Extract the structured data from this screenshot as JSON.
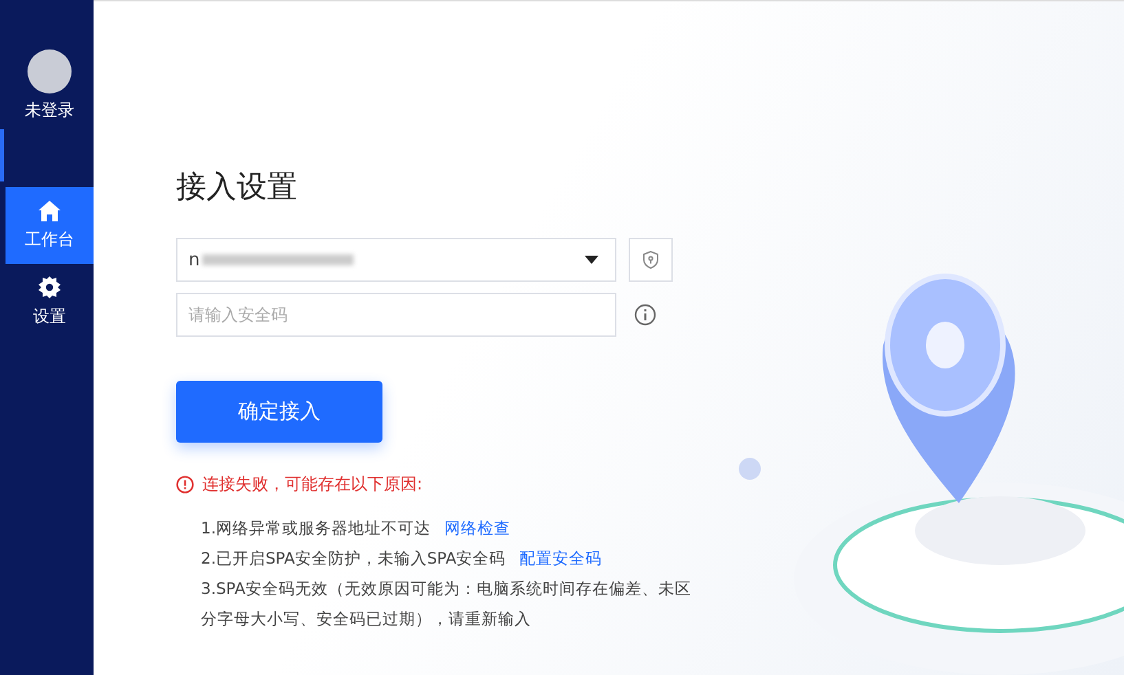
{
  "sidebar": {
    "user": {
      "name": "未登录"
    },
    "items": [
      {
        "label": "工作台",
        "kind": "home",
        "selected": true
      },
      {
        "label": "设置",
        "kind": "settings",
        "selected": false
      }
    ]
  },
  "main": {
    "title": "接入设置",
    "server_select": {
      "value": "n"
    },
    "security_code": {
      "placeholder": "请输入安全码"
    },
    "confirm_button": "确定接入",
    "error": {
      "title": "连接失败，可能存在以下原因:",
      "reasons": [
        {
          "text": "1.网络异常或服务器地址不可达",
          "link": "网络检查"
        },
        {
          "text": "2.已开启SPA安全防护，未输入SPA安全码",
          "link": "配置安全码"
        },
        {
          "text": "3.SPA安全码无效（无效原因可能为：电脑系统时间存在偏差、未区分字母大小写、安全码已过期），请重新输入"
        }
      ]
    }
  }
}
